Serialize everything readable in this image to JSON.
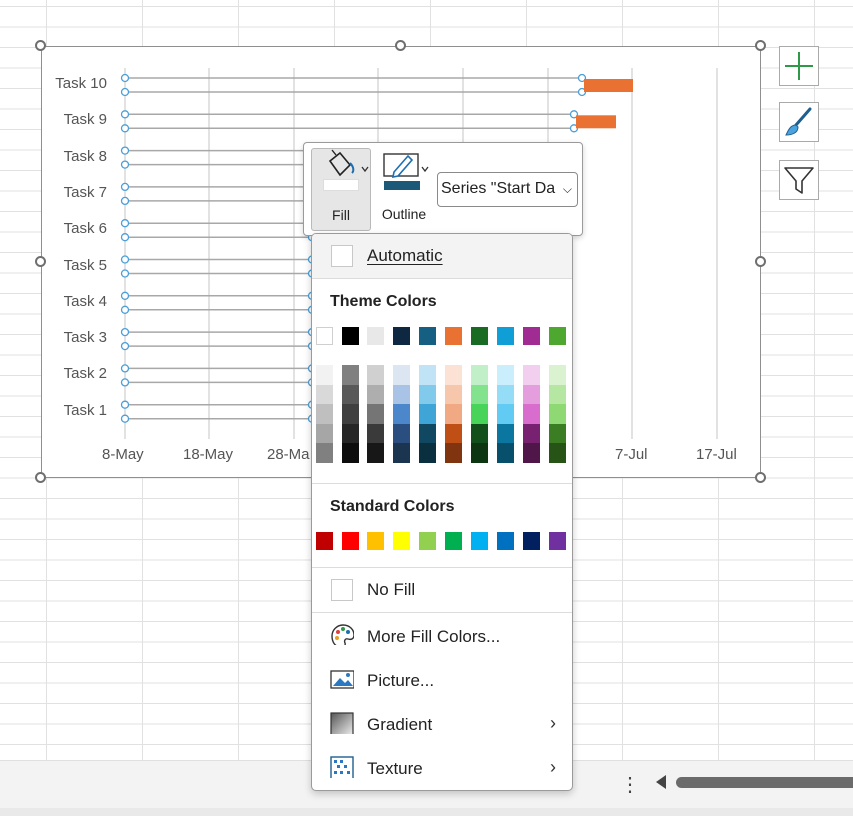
{
  "chart": {
    "tasks": [
      "Task 10",
      "Task 9",
      "Task 8",
      "Task 7",
      "Task 6",
      "Task 5",
      "Task 4",
      "Task 3",
      "Task 2",
      "Task 1"
    ],
    "date_ticks": [
      "8-May",
      "18-May",
      "28-Ma",
      "7-Jul",
      "17-Jul"
    ],
    "bar_color": "#E97132",
    "line_color": "#4A9FD8"
  },
  "minibar": {
    "fill_label": "Fill",
    "outline_label": "Outline",
    "series_value": "Series \"Start Da",
    "fill_swatch_color": "#FFFFFF",
    "outline_swatch_color": "#1C5878"
  },
  "menu": {
    "automatic": "Automatic",
    "theme_colors_title": "Theme Colors",
    "standard_colors_title": "Standard Colors",
    "no_fill": "No Fill",
    "more_fill_colors": "More Fill Colors...",
    "picture": "Picture...",
    "gradient": "Gradient",
    "texture": "Texture"
  },
  "theme_colors": {
    "top_row": [
      "#FFFFFF",
      "#000000",
      "#E8E8E8",
      "#0E2841",
      "#156082",
      "#E97132",
      "#196B24",
      "#0F9ED5",
      "#A02B93",
      "#4EA72E"
    ],
    "shades": [
      [
        "#F2F2F2",
        "#D9D9D9",
        "#BFBFBF",
        "#A6A6A6",
        "#808080"
      ],
      [
        "#808080",
        "#595959",
        "#404040",
        "#262626",
        "#0D0D0D"
      ],
      [
        "#D0D0D0",
        "#AEAEAE",
        "#757575",
        "#3A3A3A",
        "#171717"
      ],
      [
        "#DCE6F2",
        "#A9C3E6",
        "#4C87CC",
        "#2A4E7F",
        "#1B344F"
      ],
      [
        "#C0E4F5",
        "#82CAEB",
        "#3FA5D6",
        "#104862",
        "#0A3040"
      ],
      [
        "#FBE2D5",
        "#F7C7AC",
        "#F1A983",
        "#C04F15",
        "#803510"
      ],
      [
        "#C1F0C8",
        "#83E28E",
        "#47D459",
        "#134F1B",
        "#0D3512"
      ],
      [
        "#CAEEFB",
        "#95DCF7",
        "#61CBF3",
        "#0B76A0",
        "#074F6A"
      ],
      [
        "#F2CEEF",
        "#E59EDD",
        "#D86DCD",
        "#782170",
        "#501549"
      ],
      [
        "#DAF2D0",
        "#B5E6A2",
        "#8ED973",
        "#3A7D22",
        "#275317"
      ]
    ]
  },
  "standard_colors": [
    "#C00000",
    "#FF0000",
    "#FFC000",
    "#FFFF00",
    "#92D050",
    "#00B050",
    "#00B0F0",
    "#0070C0",
    "#002060",
    "#7030A0"
  ]
}
